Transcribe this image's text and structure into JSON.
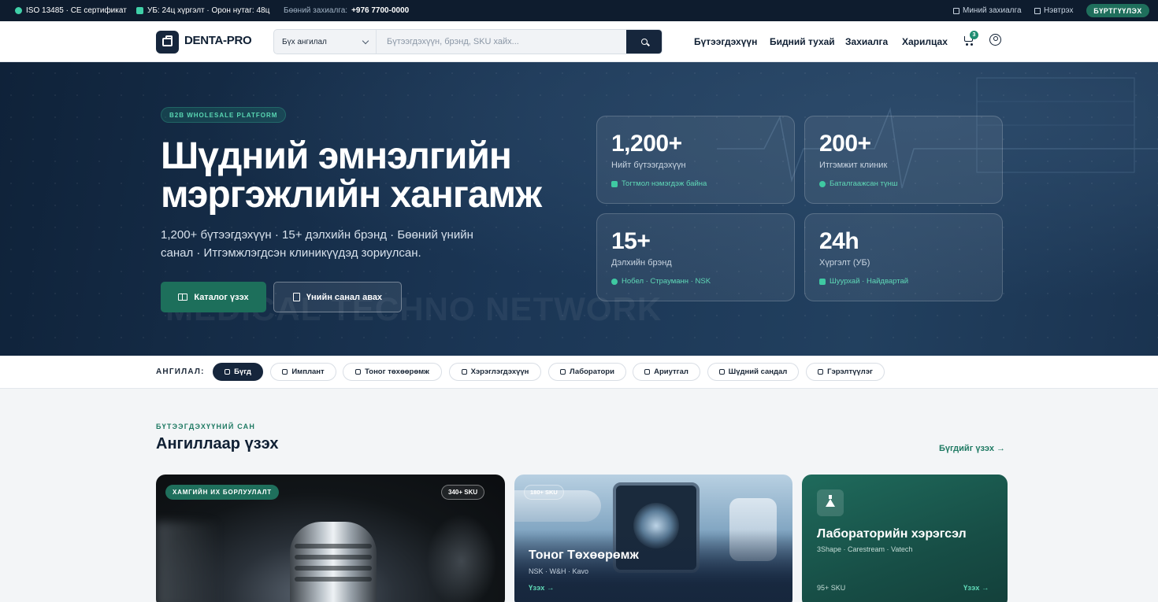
{
  "colors": {
    "topbar": "#0e1c2e",
    "brand_navy": "#16263c",
    "accent_green": "#1f6f5c",
    "accent_mint": "#5fd8b6"
  },
  "topbar": {
    "cert": "ISO 13485 · CE сертификат",
    "delivery": "УБ: 24ц хүргэлт · Орон нутаг: 48ц",
    "phone_label": "Бөөний захиалга:",
    "phone": "+976 7700-0000",
    "my_orders": "Миний захиалга",
    "login": "Нэвтрэх",
    "register": "БҮРТГҮҮЛЭХ"
  },
  "header": {
    "logo": "DENTA-PRO",
    "search": {
      "category": "Бүх ангилал",
      "placeholder": "Бүтээгдэхүүн, брэнд, SKU хайх..."
    },
    "nav": [
      "Бүтээгдэхүүн",
      "Бидний тухай",
      "Захиалга",
      "Харилцах"
    ],
    "cart_count": "3",
    "icons": [
      "shopping-bag-icon",
      "search-icon",
      "cart-icon",
      "user-icon"
    ]
  },
  "hero": {
    "pill": "B2B WHOLESALE PLATFORM",
    "title_line1": "Шүдний эмнэлгийн",
    "title_line2": "мэргэжлийн хангамж",
    "subtitle": "1,200+ бүтээгдэхүүн · 15+ дэлхийн брэнд · Бөөний үнийн санал · Итгэмжлэгдсэн клиникүүдэд зориулсан.",
    "btn_catalog": "Каталог үзэх",
    "btn_quote": "Үнийн санал авах",
    "watermark": "MEDICAL TECHNO NETWORK",
    "stats": [
      {
        "num": "1,200+",
        "label": "Нийт бүтээгдэхүүн",
        "note": "Тогтмол нэмэгдэж байна"
      },
      {
        "num": "200+",
        "label": "Итгэмжит клиник",
        "note": "Баталгаажсан түнш"
      },
      {
        "num": "15+",
        "label": "Дэлхийн брэнд",
        "note": "Нобел · Страуманн · NSK"
      },
      {
        "num": "24h",
        "label": "Хүргэлт (УБ)",
        "note": "Шуурхай · Найдвартай"
      }
    ]
  },
  "categories": {
    "label": "АНГИЛАЛ:",
    "chips": [
      "Бүгд",
      "Имплант",
      "Тоног төхөөрөмж",
      "Хэрэглэгдэхүүн",
      "Лаборатори",
      "Ариутгал",
      "Шүдний сандал",
      "Гэрэлтүүлэг"
    ],
    "active": "Бүгд"
  },
  "section": {
    "kicker": "БҮТЭЭГДЭХҮҮНИЙ САН",
    "title": "Ангиллаар үзэх",
    "see_all": "Бүгдийг үзэх →"
  },
  "cards": {
    "c1": {
      "tag": "ХАМГИЙН ИХ БОРЛУУЛАЛТ",
      "sku": "340+ SKU"
    },
    "c2": {
      "sku": "180+ SKU",
      "title": "Тоног Төхөөрөмж",
      "brands": "NSK · W&H · Kavo",
      "link": "Үзэх →"
    },
    "c3": {
      "title": "Лабораторийн хэрэгсэл",
      "brands": "3Shape · Carestream · Vatech",
      "sku": "95+ SKU",
      "link": "Үзэх →"
    }
  }
}
